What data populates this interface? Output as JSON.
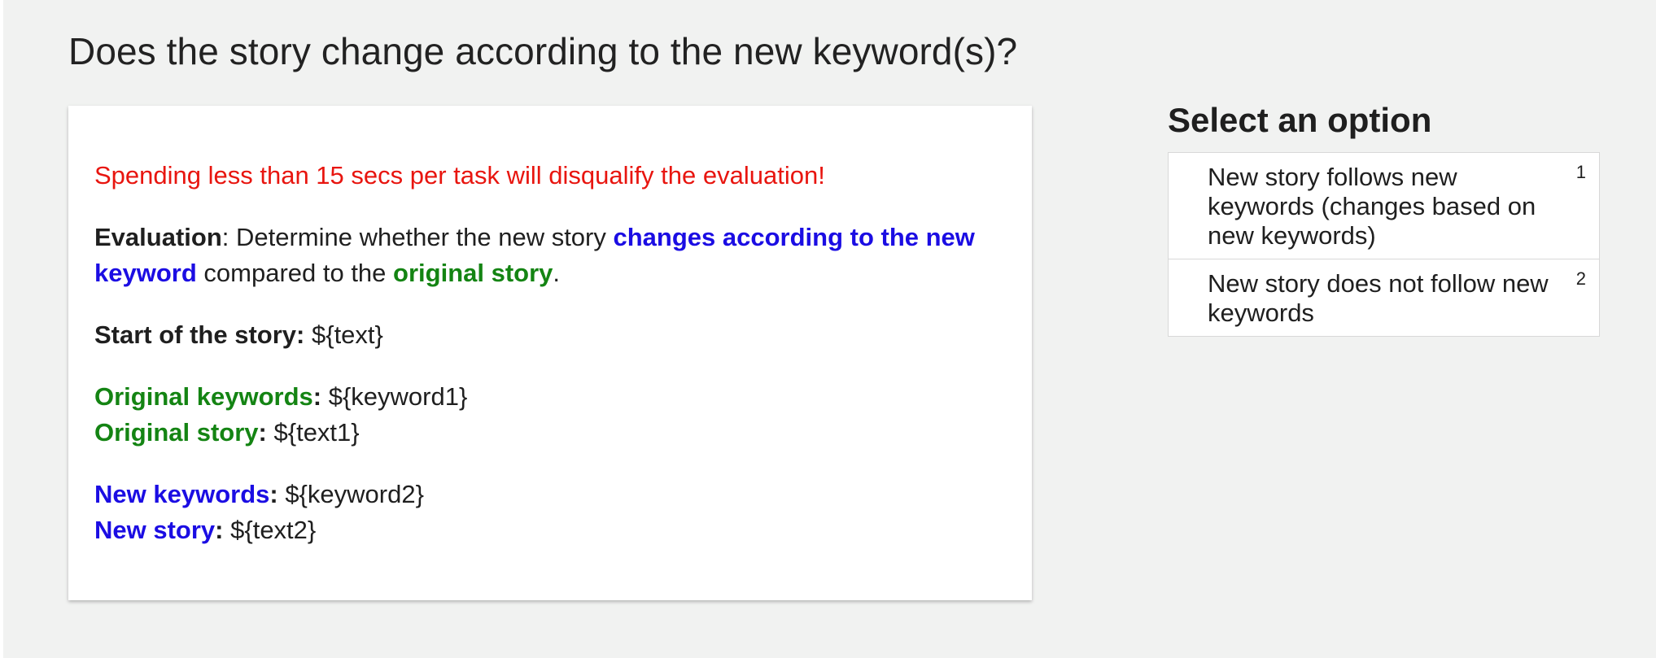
{
  "question": "Does the story change according to the new keyword(s)?",
  "instructions": {
    "warning": "Spending less than 15 secs per task will disqualify the evaluation!",
    "evaluation_label": "Evaluation",
    "evaluation_text_1": ": Determine whether the new story ",
    "evaluation_highlight_new": "changes according to the new keyword",
    "evaluation_text_2": " compared to the ",
    "evaluation_highlight_original": "original story",
    "evaluation_text_3": ".",
    "start_label": "Start of the story:",
    "start_value": " ${text}",
    "original_keywords_label": "Original keywords",
    "original_keywords_colon": ":",
    "original_keywords_value": " ${keyword1}",
    "original_story_label": "Original story",
    "original_story_colon": ":",
    "original_story_value": " ${text1}",
    "new_keywords_label": "New keywords",
    "new_keywords_colon": ":",
    "new_keywords_value": " ${keyword2}",
    "new_story_label": "New story",
    "new_story_colon": ":",
    "new_story_value": " ${text2}"
  },
  "options_panel": {
    "title": "Select an option",
    "options": [
      {
        "label": "New story follows new keywords (changes based on new keywords)",
        "key": "1"
      },
      {
        "label": "New story does not follow new keywords",
        "key": "2"
      }
    ]
  },
  "colors": {
    "warning": "#e8150f",
    "original": "#148413",
    "new": "#1b0de3",
    "background": "#f1f2f1"
  }
}
